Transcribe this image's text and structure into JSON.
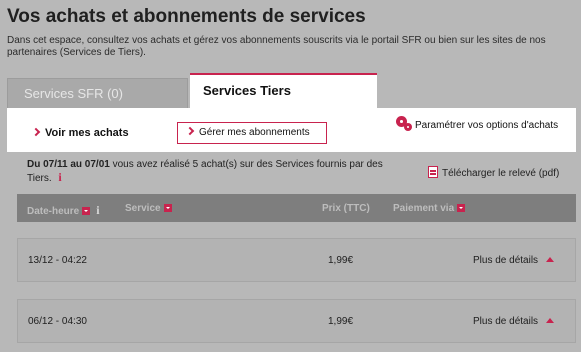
{
  "header": {
    "title": "Vos achats et abonnements de services",
    "intro": "Dans cet espace, consultez vos achats et gérez vos abonnements souscrits via le portail SFR ou bien sur les sites de nos partenaires (Services de Tiers)."
  },
  "tabs": [
    {
      "label": "Services SFR (0)"
    },
    {
      "label": "Services Tiers"
    }
  ],
  "subnav": {
    "achats": "Voir mes achats",
    "abonnements": "Gérer mes abonnements",
    "options": "Paramétrer vos options d'achats"
  },
  "summary": {
    "period": "Du 07/11 au 07/01",
    "text": " vous avez réalisé 5 achat(s) sur des Services fournis par des Tiers.",
    "info": "i",
    "download": "Télécharger le relevé (pdf)"
  },
  "table": {
    "headers": {
      "date": "Date-heure",
      "info": "i",
      "service": "Service",
      "price": "Prix (TTC)",
      "payment": "Paiement via"
    },
    "rows": [
      {
        "date": "13/12 - 04:22",
        "service": "",
        "price": "1,99€",
        "details": "Plus de détails"
      },
      {
        "date": "06/12 - 04:30",
        "service": "",
        "price": "1,99€",
        "details": "Plus de détails"
      }
    ]
  },
  "colors": {
    "accent": "#c8234e",
    "overlay": "#b8b8b8",
    "header_bg": "#7e7e7e"
  }
}
